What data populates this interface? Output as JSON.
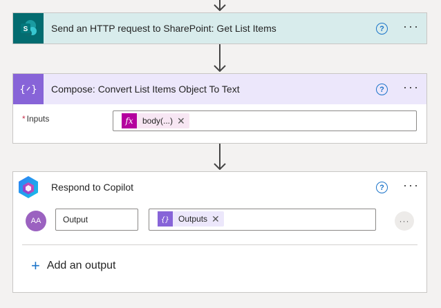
{
  "steps": [
    {
      "title": "Send an HTTP request to SharePoint: Get List Items",
      "icon": "sharepoint-icon",
      "help": "?",
      "more": "···"
    },
    {
      "title": "Compose: Convert List Items Object To Text",
      "icon": "compose-braces-icon",
      "help": "?",
      "more": "···",
      "field": {
        "required_mark": "*",
        "label": "Inputs",
        "token_text": "body(...)",
        "token_icon": "fx"
      }
    },
    {
      "title": "Respond to Copilot",
      "icon": "copilot-icon",
      "help": "?",
      "more": "···",
      "output": {
        "avatar_text": "AA",
        "name": "Output",
        "token_text": "Outputs",
        "row_more": "···"
      },
      "add_output_label": "Add an output",
      "add_output_plus": "+"
    }
  ],
  "colors": {
    "sharepoint_brand": "#036c70",
    "compose_brand": "#8764d8",
    "fx_token": "#b4009e",
    "accent_blue": "#1a73c9"
  }
}
